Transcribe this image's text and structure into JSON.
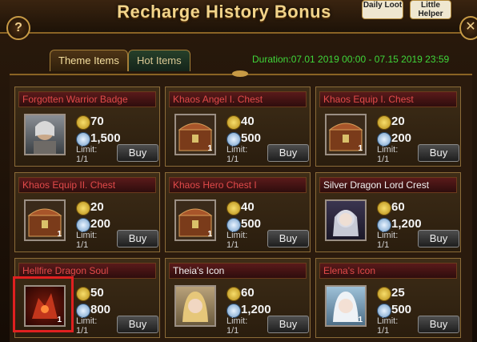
{
  "header": {
    "title": "Recharge History Bonus",
    "help": "?",
    "close": "✕"
  },
  "top_icons": [
    "Daily Loot",
    "Little Helper"
  ],
  "tabs": [
    "Theme Items",
    "Hot Items"
  ],
  "duration": "Duration:07.01 2019 00:00 - 07.15 2019 23:59",
  "buy_label": "Buy",
  "items": [
    {
      "name": "Forgotten Warrior Badge",
      "gold": "70",
      "gem": "1,500",
      "limit": "Limit:",
      "limit_val": "1/1",
      "qty": ""
    },
    {
      "name": "Khaos Angel I. Chest",
      "gold": "40",
      "gem": "500",
      "limit": "Limit:",
      "limit_val": "1/1",
      "qty": "1"
    },
    {
      "name": "Khaos Equip I. Chest",
      "gold": "20",
      "gem": "200",
      "limit": "Limit:",
      "limit_val": "1/1",
      "qty": "1"
    },
    {
      "name": "Khaos Equip II. Chest",
      "gold": "20",
      "gem": "200",
      "limit": "Limit:",
      "limit_val": "1/1",
      "qty": "1"
    },
    {
      "name": "Khaos Hero Chest I",
      "gold": "40",
      "gem": "500",
      "limit": "Limit:",
      "limit_val": "1/1",
      "qty": "1"
    },
    {
      "name": "Silver Dragon Lord Crest",
      "gold": "60",
      "gem": "1,200",
      "limit": "Limit:",
      "limit_val": "1/1",
      "qty": ""
    },
    {
      "name": "Hellfire Dragon Soul",
      "gold": "50",
      "gem": "800",
      "limit": "Limit:",
      "limit_val": "1/1",
      "qty": "1"
    },
    {
      "name": "Theia's Icon",
      "gold": "60",
      "gem": "1,200",
      "limit": "Limit:",
      "limit_val": "1/1",
      "qty": ""
    },
    {
      "name": "Elena's Icon",
      "gold": "25",
      "gem": "500",
      "limit": "Limit:",
      "limit_val": "1/1",
      "qty": "1"
    }
  ],
  "colors": {
    "title_red": "#e24a4a",
    "title_white": "#f2f2f2",
    "duration_green": "#3fd63a",
    "highlight": "#e02020"
  }
}
